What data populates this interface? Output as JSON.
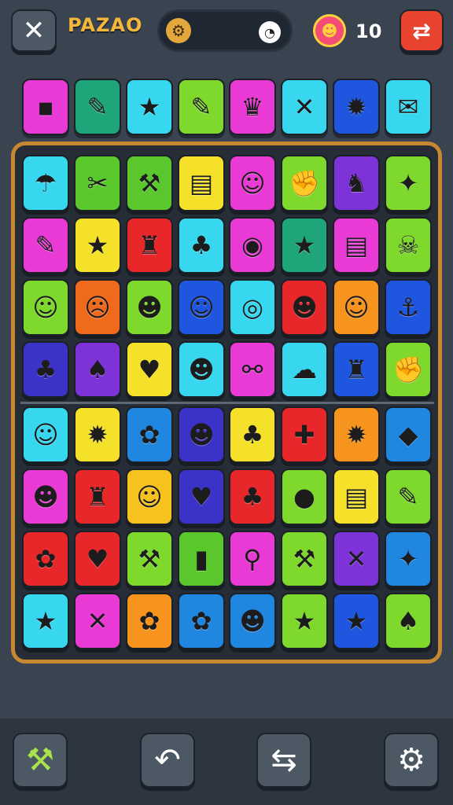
{
  "header": {
    "title": "PAZAO",
    "close_icon": "✕",
    "progress_gear_icon": "⚙",
    "progress_clock_icon": "◔",
    "score": "10",
    "score_icon": "☻",
    "shuffle_icon": "⇄"
  },
  "top_row": [
    {
      "icon": "▪",
      "color": "#e93ad6"
    },
    {
      "icon": "✎",
      "color": "#1fa57a"
    },
    {
      "icon": "★",
      "color": "#37d7f0"
    },
    {
      "icon": "✎",
      "color": "#7fd92c"
    },
    {
      "icon": "♛",
      "color": "#e93ad6"
    },
    {
      "icon": "✕",
      "color": "#37d7f0"
    },
    {
      "icon": "✹",
      "color": "#1f56e0"
    },
    {
      "icon": "✉",
      "color": "#37d7f0"
    }
  ],
  "board": [
    [
      {
        "icon": "☂",
        "color": "#37d7f0"
      },
      {
        "icon": "✂",
        "color": "#5ac72c"
      },
      {
        "icon": "⚒",
        "color": "#5ac72c"
      },
      {
        "icon": "▤",
        "color": "#f5e12a"
      },
      {
        "icon": "☺",
        "color": "#e93ad6"
      },
      {
        "icon": "✊",
        "color": "#7fd92c"
      },
      {
        "icon": "♞",
        "color": "#7d33d8"
      },
      {
        "icon": "✦",
        "color": "#7fd92c"
      }
    ],
    [
      {
        "icon": "✎",
        "color": "#e93ad6"
      },
      {
        "icon": "★",
        "color": "#f5e12a"
      },
      {
        "icon": "♜",
        "color": "#e8272b"
      },
      {
        "icon": "♣",
        "color": "#37d7f0"
      },
      {
        "icon": "◉",
        "color": "#e93ad6"
      },
      {
        "icon": "★",
        "color": "#1fa57a"
      },
      {
        "icon": "▤",
        "color": "#e93ad6"
      },
      {
        "icon": "☠",
        "color": "#7fd92c"
      }
    ],
    [
      {
        "icon": "☺",
        "color": "#7fd92c"
      },
      {
        "icon": "☹",
        "color": "#f06a1e"
      },
      {
        "icon": "☻",
        "color": "#7fd92c"
      },
      {
        "icon": "☺",
        "color": "#1f56e0"
      },
      {
        "icon": "◎",
        "color": "#37d7f0"
      },
      {
        "icon": "☻",
        "color": "#e8272b"
      },
      {
        "icon": "☺",
        "color": "#f7941d"
      },
      {
        "icon": "⚓",
        "color": "#1f56e0"
      }
    ],
    [
      {
        "icon": "♣",
        "color": "#3b33c8"
      },
      {
        "icon": "♠",
        "color": "#7d33d8"
      },
      {
        "icon": "♥",
        "color": "#f5e12a"
      },
      {
        "icon": "☻",
        "color": "#37d7f0"
      },
      {
        "icon": "⚯",
        "color": "#e93ad6"
      },
      {
        "icon": "☁",
        "color": "#37d7f0"
      },
      {
        "icon": "♜",
        "color": "#1f56e0"
      },
      {
        "icon": "✊",
        "color": "#7fd92c"
      }
    ],
    [
      {
        "icon": "☺",
        "color": "#37d7f0"
      },
      {
        "icon": "✹",
        "color": "#f5e12a"
      },
      {
        "icon": "✿",
        "color": "#1f87e0"
      },
      {
        "icon": "☻",
        "color": "#3b33c8"
      },
      {
        "icon": "♣",
        "color": "#f5e12a"
      },
      {
        "icon": "✚",
        "color": "#e8272b"
      },
      {
        "icon": "✹",
        "color": "#f7941d"
      },
      {
        "icon": "◆",
        "color": "#1f87e0"
      }
    ],
    [
      {
        "icon": "☻",
        "color": "#e93ad6"
      },
      {
        "icon": "♜",
        "color": "#e8272b"
      },
      {
        "icon": "☺",
        "color": "#f7c11e"
      },
      {
        "icon": "♥",
        "color": "#3b33c8"
      },
      {
        "icon": "♣",
        "color": "#e8272b"
      },
      {
        "icon": "●",
        "color": "#7fd92c"
      },
      {
        "icon": "▤",
        "color": "#f5e12a"
      },
      {
        "icon": "✎",
        "color": "#7fd92c"
      }
    ],
    [
      {
        "icon": "✿",
        "color": "#e8272b"
      },
      {
        "icon": "♥",
        "color": "#e8272b"
      },
      {
        "icon": "⚒",
        "color": "#7fd92c"
      },
      {
        "icon": "▮",
        "color": "#5ac72c"
      },
      {
        "icon": "⚲",
        "color": "#e93ad6"
      },
      {
        "icon": "⚒",
        "color": "#7fd92c"
      },
      {
        "icon": "✕",
        "color": "#7d33d8"
      },
      {
        "icon": "✦",
        "color": "#1f87e0"
      }
    ],
    [
      {
        "icon": "★",
        "color": "#37d7f0"
      },
      {
        "icon": "✕",
        "color": "#e93ad6"
      },
      {
        "icon": "✿",
        "color": "#f7941d"
      },
      {
        "icon": "✿",
        "color": "#1f87e0"
      },
      {
        "icon": "☻",
        "color": "#1f87e0"
      },
      {
        "icon": "★",
        "color": "#7fd92c"
      },
      {
        "icon": "★",
        "color": "#1f56e0"
      },
      {
        "icon": "♠",
        "color": "#7fd92c"
      }
    ]
  ],
  "bottom_bar": {
    "hammer_icon": "⚒",
    "undo_icon": "↶",
    "swap_icon": "⇆",
    "settings_icon": "⚙"
  }
}
